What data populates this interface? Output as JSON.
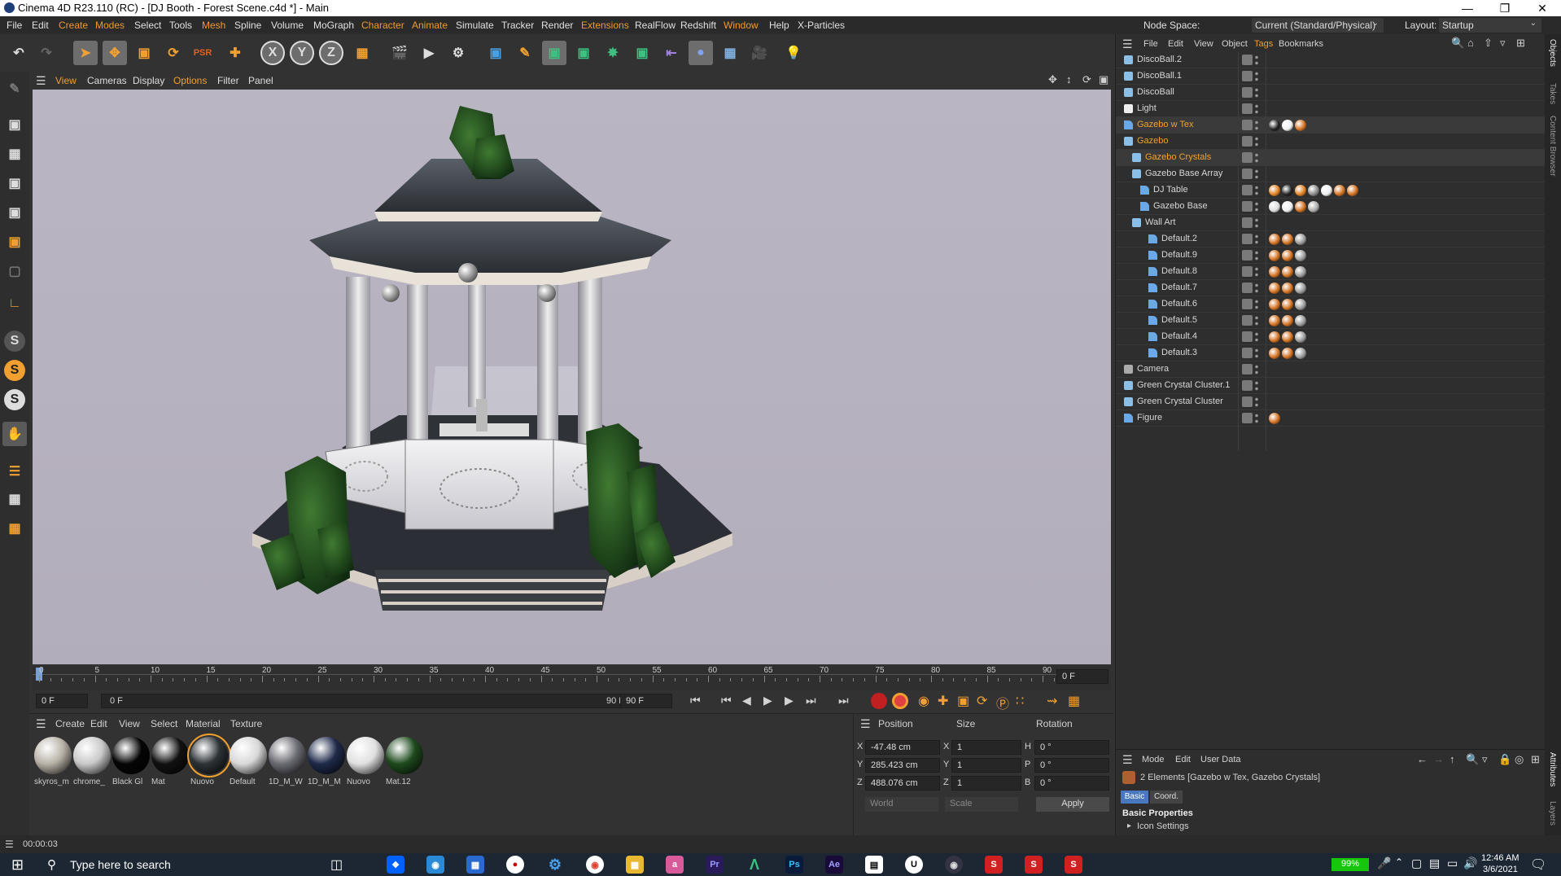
{
  "window": {
    "title": "Cinema 4D R23.110 (RC) - [DJ Booth - Forest Scene.c4d *] - Main"
  },
  "menu": {
    "items": [
      "File",
      "Edit",
      "Create",
      "Modes",
      "Select",
      "Tools",
      "Mesh",
      "Spline",
      "Volume",
      "MoGraph",
      "Character",
      "Animate",
      "Simulate",
      "Tracker",
      "Render",
      "Extensions",
      "RealFlow",
      "Redshift",
      "Window",
      "Help",
      "X-Particles"
    ],
    "node_space_label": "Node Space:",
    "node_space_value": "Current (Standard/Physical)",
    "layout_label": "Layout:",
    "layout_value": "Startup"
  },
  "viewport_menu": [
    "View",
    "Cameras",
    "Display",
    "Options",
    "Filter",
    "Panel"
  ],
  "toolbar_axes": [
    "X",
    "Y",
    "Z"
  ],
  "left_tools_s": [
    "S",
    "S",
    "S"
  ],
  "timeline": {
    "ticks": [
      "0",
      "5",
      "10",
      "15",
      "20",
      "25",
      "30",
      "35",
      "40",
      "45",
      "50",
      "55",
      "60",
      "65",
      "70",
      "75",
      "80",
      "85",
      "90"
    ],
    "current_frame": "0 F",
    "start_field": "0 F",
    "range_start": "0 F",
    "range_end": "90 F",
    "end_field": "90 F"
  },
  "material_menu": [
    "Create",
    "Edit",
    "View",
    "Select",
    "Material",
    "Texture"
  ],
  "materials": [
    {
      "name": "skyros_m",
      "color": "#b8b2a8"
    },
    {
      "name": "chrome_",
      "color": "#c9c9c9"
    },
    {
      "name": "Black Gl",
      "color": "#050505"
    },
    {
      "name": "Mat",
      "color": "#111111"
    },
    {
      "name": "Nuovo",
      "color": "#2c3236"
    },
    {
      "name": "Default",
      "color": "#d8d8d8"
    },
    {
      "name": "1D_M_W",
      "color": "#6b6b73"
    },
    {
      "name": "1D_M_M",
      "color": "#1f2a4a"
    },
    {
      "name": "Nuovo",
      "color": "#e0e0e0"
    },
    {
      "name": "Mat.12",
      "color": "#1e4a1e"
    }
  ],
  "coordinates": {
    "headers": [
      "Position",
      "Size",
      "Rotation"
    ],
    "rows": [
      {
        "axis": "X",
        "pos": "-47.48 cm",
        "size_axis": "X",
        "size": "1",
        "rot_axis": "H",
        "rot": "0 °"
      },
      {
        "axis": "Y",
        "pos": "285.423 cm",
        "size_axis": "Y",
        "size": "1",
        "rot_axis": "P",
        "rot": "0 °"
      },
      {
        "axis": "Z",
        "pos": "488.076 cm",
        "size_axis": "Z",
        "size": "1",
        "rot_axis": "B",
        "rot": "0 °"
      }
    ],
    "world_select": "World",
    "scale_select": "Scale",
    "apply": "Apply"
  },
  "objects_menu": [
    "File",
    "Edit",
    "View",
    "Object",
    "Tags",
    "Bookmarks"
  ],
  "objects": [
    {
      "name": "DiscoBall.2",
      "indent": 0,
      "orange": false,
      "type": "null"
    },
    {
      "name": "DiscoBall.1",
      "indent": 0,
      "orange": false,
      "type": "null"
    },
    {
      "name": "DiscoBall",
      "indent": 0,
      "orange": false,
      "type": "null"
    },
    {
      "name": "Light",
      "indent": 0,
      "orange": false,
      "type": "light"
    },
    {
      "name": "Gazebo w Tex",
      "indent": 0,
      "orange": true,
      "type": "poly"
    },
    {
      "name": "Gazebo",
      "indent": 0,
      "orange": true,
      "type": "null"
    },
    {
      "name": "Gazebo Crystals",
      "indent": 1,
      "orange": true,
      "type": "null"
    },
    {
      "name": "Gazebo Base Array",
      "indent": 1,
      "orange": false,
      "type": "null"
    },
    {
      "name": "DJ Table",
      "indent": 2,
      "orange": false,
      "type": "poly"
    },
    {
      "name": "Gazebo Base",
      "indent": 2,
      "orange": false,
      "type": "poly"
    },
    {
      "name": "Wall Art",
      "indent": 1,
      "orange": false,
      "type": "null"
    },
    {
      "name": "Default.2",
      "indent": 3,
      "orange": false,
      "type": "poly"
    },
    {
      "name": "Default.9",
      "indent": 3,
      "orange": false,
      "type": "poly"
    },
    {
      "name": "Default.8",
      "indent": 3,
      "orange": false,
      "type": "poly"
    },
    {
      "name": "Default.7",
      "indent": 3,
      "orange": false,
      "type": "poly"
    },
    {
      "name": "Default.6",
      "indent": 3,
      "orange": false,
      "type": "poly"
    },
    {
      "name": "Default.5",
      "indent": 3,
      "orange": false,
      "type": "poly"
    },
    {
      "name": "Default.4",
      "indent": 3,
      "orange": false,
      "type": "poly"
    },
    {
      "name": "Default.3",
      "indent": 3,
      "orange": false,
      "type": "poly"
    },
    {
      "name": "Camera",
      "indent": 0,
      "orange": false,
      "type": "camera"
    },
    {
      "name": "Green Crystal Cluster.1",
      "indent": 0,
      "orange": false,
      "type": "null"
    },
    {
      "name": "Green Crystal Cluster",
      "indent": 0,
      "orange": false,
      "type": "null"
    },
    {
      "name": "Figure",
      "indent": 0,
      "orange": false,
      "type": "poly"
    }
  ],
  "attributes": {
    "menu": [
      "Mode",
      "Edit",
      "User Data"
    ],
    "selection": "2 Elements [Gazebo w Tex, Gazebo Crystals]",
    "tabs": [
      "Basic",
      "Coord."
    ],
    "section": "Basic Properties",
    "subsection": "Icon Settings"
  },
  "right_tabs": [
    "Objects",
    "Takes",
    "Content Browser",
    "Attributes",
    "Layers"
  ],
  "status": {
    "time": "00:00:03"
  },
  "taskbar": {
    "search_placeholder": "Type here to search",
    "battery": "99%",
    "time": "12:46 AM",
    "date": "3/6/2021",
    "apps": [
      "Pr",
      "Ps",
      "Ae"
    ]
  }
}
